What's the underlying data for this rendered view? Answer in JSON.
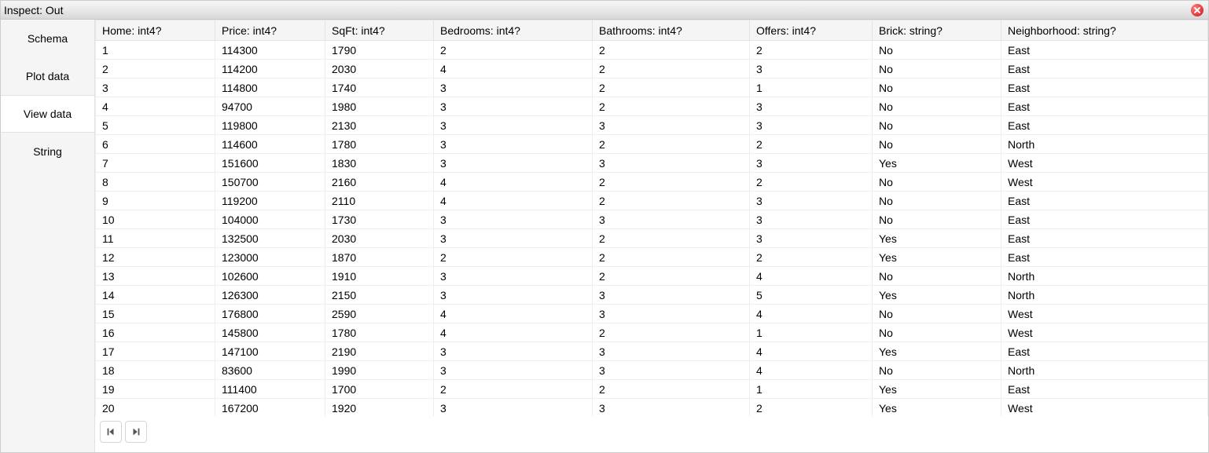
{
  "window": {
    "title": "Inspect: Out"
  },
  "sidebar": {
    "tabs": [
      {
        "label": "Schema",
        "active": false
      },
      {
        "label": "Plot data",
        "active": false
      },
      {
        "label": "View data",
        "active": true
      },
      {
        "label": "String",
        "active": false
      }
    ]
  },
  "table": {
    "columns": [
      "Home: int4?",
      "Price: int4?",
      "SqFt: int4?",
      "Bedrooms: int4?",
      "Bathrooms: int4?",
      "Offers: int4?",
      "Brick: string?",
      "Neighborhood: string?"
    ],
    "rows": [
      [
        "1",
        "114300",
        "1790",
        "2",
        "2",
        "2",
        "No",
        "East"
      ],
      [
        "2",
        "114200",
        "2030",
        "4",
        "2",
        "3",
        "No",
        "East"
      ],
      [
        "3",
        "114800",
        "1740",
        "3",
        "2",
        "1",
        "No",
        "East"
      ],
      [
        "4",
        "94700",
        "1980",
        "3",
        "2",
        "3",
        "No",
        "East"
      ],
      [
        "5",
        "119800",
        "2130",
        "3",
        "3",
        "3",
        "No",
        "East"
      ],
      [
        "6",
        "114600",
        "1780",
        "3",
        "2",
        "2",
        "No",
        "North"
      ],
      [
        "7",
        "151600",
        "1830",
        "3",
        "3",
        "3",
        "Yes",
        "West"
      ],
      [
        "8",
        "150700",
        "2160",
        "4",
        "2",
        "2",
        "No",
        "West"
      ],
      [
        "9",
        "119200",
        "2110",
        "4",
        "2",
        "3",
        "No",
        "East"
      ],
      [
        "10",
        "104000",
        "1730",
        "3",
        "3",
        "3",
        "No",
        "East"
      ],
      [
        "11",
        "132500",
        "2030",
        "3",
        "2",
        "3",
        "Yes",
        "East"
      ],
      [
        "12",
        "123000",
        "1870",
        "2",
        "2",
        "2",
        "Yes",
        "East"
      ],
      [
        "13",
        "102600",
        "1910",
        "3",
        "2",
        "4",
        "No",
        "North"
      ],
      [
        "14",
        "126300",
        "2150",
        "3",
        "3",
        "5",
        "Yes",
        "North"
      ],
      [
        "15",
        "176800",
        "2590",
        "4",
        "3",
        "4",
        "No",
        "West"
      ],
      [
        "16",
        "145800",
        "1780",
        "4",
        "2",
        "1",
        "No",
        "West"
      ],
      [
        "17",
        "147100",
        "2190",
        "3",
        "3",
        "4",
        "Yes",
        "East"
      ],
      [
        "18",
        "83600",
        "1990",
        "3",
        "3",
        "4",
        "No",
        "North"
      ],
      [
        "19",
        "111400",
        "1700",
        "2",
        "2",
        "1",
        "Yes",
        "East"
      ],
      [
        "20",
        "167200",
        "1920",
        "3",
        "3",
        "2",
        "Yes",
        "West"
      ]
    ]
  }
}
